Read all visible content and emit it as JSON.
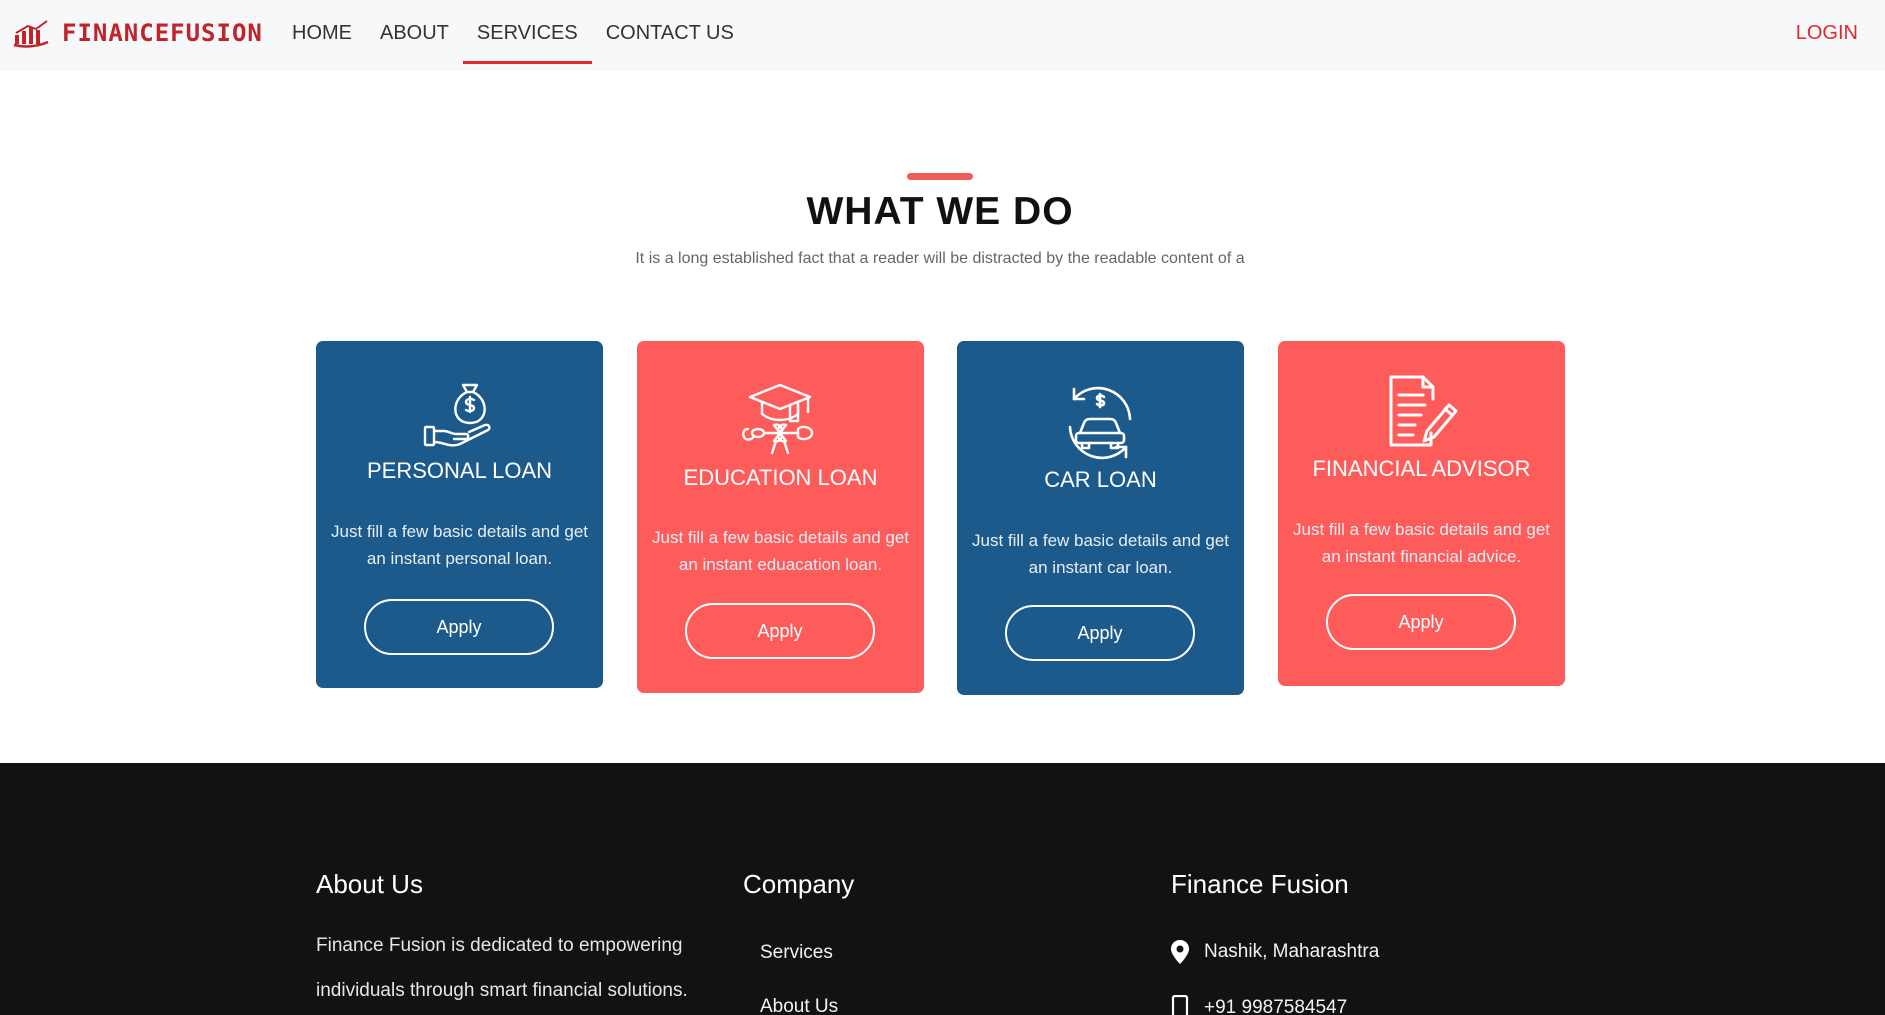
{
  "brand": {
    "name": "FINANCEFUSION",
    "accent": "#e0292e",
    "blue": "#1c5a8c",
    "red": "#fe5b5b"
  },
  "nav": {
    "items": [
      {
        "label": "HOME"
      },
      {
        "label": "ABOUT"
      },
      {
        "label": "SERVICES",
        "active": true
      },
      {
        "label": "CONTACT US"
      }
    ],
    "login": "LOGIN"
  },
  "section": {
    "title": "WHAT WE DO",
    "subtitle": "It is a long established fact that a reader will be distracted by the readable content of a"
  },
  "cards": [
    {
      "title": "PERSONAL LOAN",
      "desc": "Just fill a few basic details and get an instant personal loan.",
      "button": "Apply",
      "icon": "money-bag-hand-icon",
      "color": "blue"
    },
    {
      "title": "EDUCATION LOAN",
      "desc": "Just fill a few basic details and get an instant eduacation loan.",
      "button": "Apply",
      "icon": "graduation-cap-icon",
      "color": "red"
    },
    {
      "title": "CAR LOAN",
      "desc": "Just fill a few basic details and get an instant car loan.",
      "button": "Apply",
      "icon": "car-dollar-icon",
      "color": "blue"
    },
    {
      "title": "FINANCIAL ADVISOR",
      "desc": "Just fill a few basic details and get an instant financial advice.",
      "button": "Apply",
      "icon": "document-pen-icon",
      "color": "red"
    }
  ],
  "footer": {
    "about": {
      "title": "About Us",
      "text": "Finance Fusion is dedicated to empowering individuals through smart financial solutions."
    },
    "company": {
      "title": "Company",
      "links": [
        "Services",
        "About Us"
      ]
    },
    "contact": {
      "title": "Finance Fusion",
      "location": "Nashik, Maharashtra",
      "phone": "+91 9987584547"
    }
  }
}
